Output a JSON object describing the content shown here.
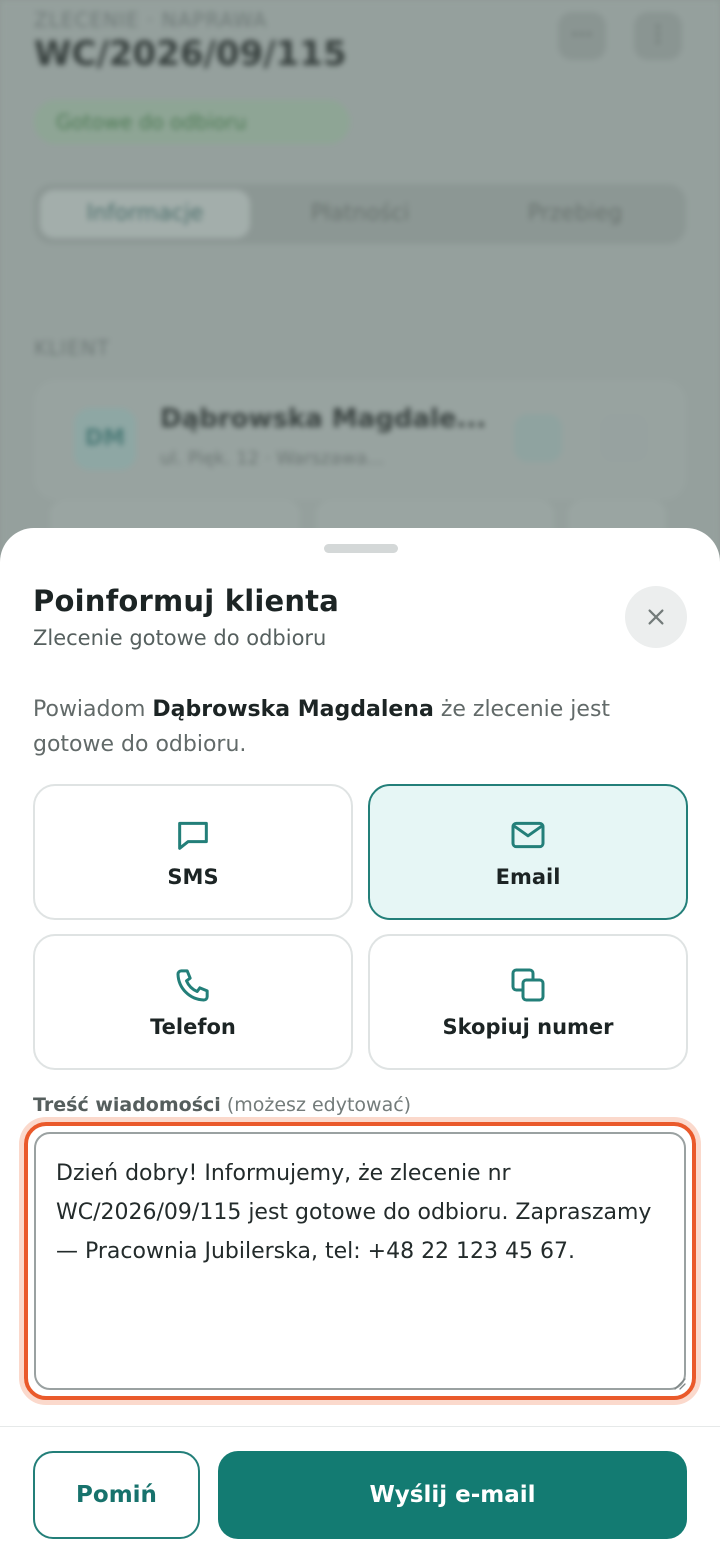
{
  "background": {
    "subtitle": "ZLECENIE · NAPRAWA",
    "order_number": "WC/2026/09/115",
    "status": "Gotowe do odbioru",
    "tabs": [
      "Informacje",
      "Płatności",
      "Przebieg"
    ],
    "section": "KLIENT",
    "client_name": "Dąbrowska Magdale...",
    "client_address": "ul. Pięk. 12 · Warszawa...",
    "avatar_initials": "DM"
  },
  "sheet": {
    "title": "Poinformuj klienta",
    "subtitle": "Zlecenie gotowe do odbioru",
    "desc_before": "Powiadom ",
    "client_name": "Dąbrowska Magdalena",
    "desc_after": " że zlecenie jest gotowe do odbioru.",
    "options": {
      "sms": "SMS",
      "email": "Email",
      "phone": "Telefon",
      "copy": "Skopiuj numer"
    },
    "selected_option": "email",
    "message_label": "Treść wiadomości",
    "message_hint": " (możesz edytować)",
    "message": "Dzień dobry! Informujemy, że zlecenie nr WC/2026/09/115 jest gotowe do odbioru. Zapraszamy — Pracownia Jubilerska, tel: +48 22 123 45 67.",
    "skip_label": "Pomiń",
    "send_label": "Wyślij e-mail"
  },
  "colors": {
    "accent": "#137b72",
    "selected_bg": "#e6f6f5",
    "focus_ring": "#ea5a2b"
  }
}
